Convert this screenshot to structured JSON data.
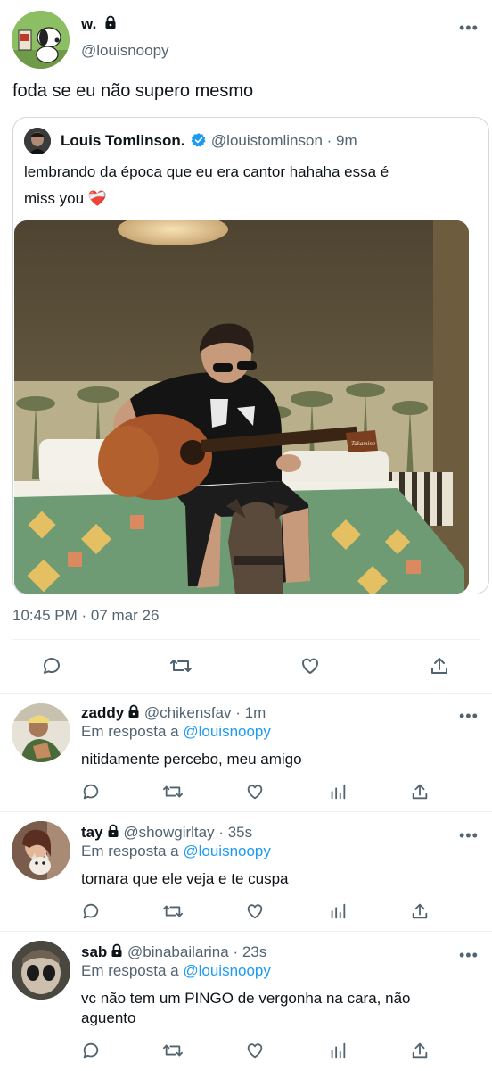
{
  "tweet": {
    "author_name": "w.",
    "author_handle": "@louisnoopy",
    "text": "foda se eu não supero mesmo",
    "timestamp": "10:45 PM · 07 mar 26"
  },
  "quoted": {
    "author_name": "Louis Tomlinson.",
    "author_handle": "@louistomlinson",
    "time": "· 9m",
    "text_line1": "lembrando da época que eu era cantor hahaha essa é",
    "text_line2": "miss you",
    "emoji": "❤️‍🩹",
    "guitar_brand": "Takamine"
  },
  "actions": [
    "reply-icon",
    "retweet-icon",
    "like-icon",
    "share-icon"
  ],
  "replies": [
    {
      "name": "zaddy",
      "handle": "@chikensfav",
      "time": "· 1m",
      "reply_prefix": "Em resposta a",
      "reply_to": "@louisnoopy",
      "text": "nitidamente percebo, meu amigo"
    },
    {
      "name": "tay",
      "handle": "@showgirltay",
      "time": "· 35s",
      "reply_prefix": "Em resposta a",
      "reply_to": "@louisnoopy",
      "text": "tomara que ele veja e te cuspa"
    },
    {
      "name": "sab",
      "handle": "@binabailarina",
      "time": "· 23s",
      "reply_prefix": "Em resposta a",
      "reply_to": "@louisnoopy",
      "text": "vc não tem um PINGO de vergonha na cara, não aguento"
    }
  ],
  "colors": {
    "accent": "#1d9bf0",
    "muted": "#536471",
    "separator": "#eff3f4",
    "verified": "#1d9bf0"
  }
}
